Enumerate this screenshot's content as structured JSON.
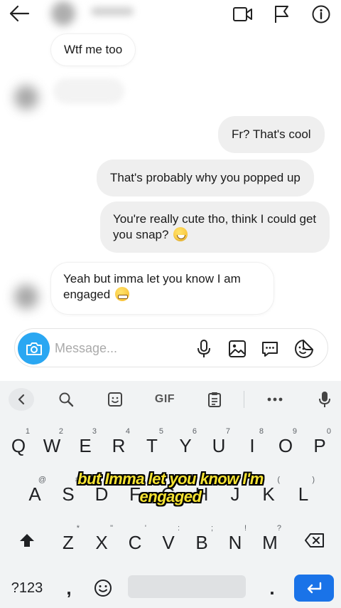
{
  "header": {
    "icons": [
      "back-arrow-icon",
      "video-camera-icon",
      "flag-icon",
      "info-icon"
    ]
  },
  "messages": [
    {
      "direction": "incoming",
      "text": "Wtf me too"
    },
    {
      "direction": "outgoing",
      "text": "Fr? That's cool"
    },
    {
      "direction": "outgoing",
      "text": "That's probably why you popped up"
    },
    {
      "direction": "outgoing",
      "text": "You're really cute tho, think I could get you snap?",
      "emoji": "grinning-sweat-emoji"
    },
    {
      "direction": "incoming",
      "text": "Yeah but imma let you know I am engaged",
      "emoji": "grimacing-emoji"
    }
  ],
  "composer": {
    "placeholder": "Message..."
  },
  "keyboard": {
    "toolbar": {
      "gif_label": "GIF"
    },
    "row1": [
      {
        "letter": "Q",
        "hint": "1"
      },
      {
        "letter": "W",
        "hint": "2"
      },
      {
        "letter": "E",
        "hint": "3"
      },
      {
        "letter": "R",
        "hint": "4"
      },
      {
        "letter": "T",
        "hint": "5"
      },
      {
        "letter": "Y",
        "hint": "6"
      },
      {
        "letter": "U",
        "hint": "7"
      },
      {
        "letter": "I",
        "hint": "8"
      },
      {
        "letter": "O",
        "hint": "9"
      },
      {
        "letter": "P",
        "hint": "0"
      }
    ],
    "row2": [
      {
        "letter": "A",
        "hint": "@"
      },
      {
        "letter": "S",
        "hint": "#"
      },
      {
        "letter": "D",
        "hint": "$"
      },
      {
        "letter": "F",
        "hint": "_"
      },
      {
        "letter": "G",
        "hint": "&"
      },
      {
        "letter": "H",
        "hint": "-"
      },
      {
        "letter": "J",
        "hint": "+"
      },
      {
        "letter": "K",
        "hint": "("
      },
      {
        "letter": "L",
        "hint": ")"
      }
    ],
    "row3": [
      {
        "letter": "Z",
        "hint": "*"
      },
      {
        "letter": "X",
        "hint": "\""
      },
      {
        "letter": "C",
        "hint": "'"
      },
      {
        "letter": "V",
        "hint": ":"
      },
      {
        "letter": "B",
        "hint": ";"
      },
      {
        "letter": "N",
        "hint": "!"
      },
      {
        "letter": "M",
        "hint": "?"
      }
    ],
    "bottom": {
      "symbols_label": "?123",
      "comma": ",",
      "period": "."
    }
  },
  "caption": {
    "line1": "but Imma let you know I'm",
    "line2": "engaged"
  },
  "colors": {
    "accent_blue": "#2aa7f2",
    "enter_blue": "#1a73e8",
    "caption_yellow": "#f6e332",
    "outgoing_bubble": "#efefef"
  }
}
